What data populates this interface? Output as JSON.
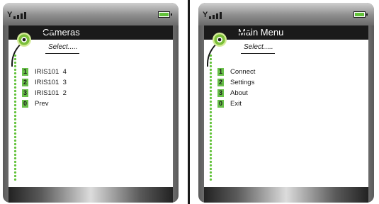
{
  "colors": {
    "accent_green": "#69c14a",
    "titlebar_bg": "#1a1a1a",
    "battery_fill": "#62c23a"
  },
  "status": {
    "signal_icon": "antenna-signal-icon",
    "battery_icon": "battery-icon"
  },
  "left_screen": {
    "title": "Cameras",
    "subtitle": "Select.....",
    "items": [
      {
        "num": "1",
        "label": "IRIS101  4"
      },
      {
        "num": "2",
        "label": "IRIS101  3"
      },
      {
        "num": "3",
        "label": "IRIS101  2"
      },
      {
        "num": "0",
        "label": "Prev"
      }
    ]
  },
  "right_screen": {
    "title": "Main Menu",
    "subtitle": "Select.....",
    "items": [
      {
        "num": "1",
        "label": "Connect"
      },
      {
        "num": "2",
        "label": "Settings"
      },
      {
        "num": "3",
        "label": "About"
      },
      {
        "num": "0",
        "label": "Exit"
      }
    ]
  }
}
